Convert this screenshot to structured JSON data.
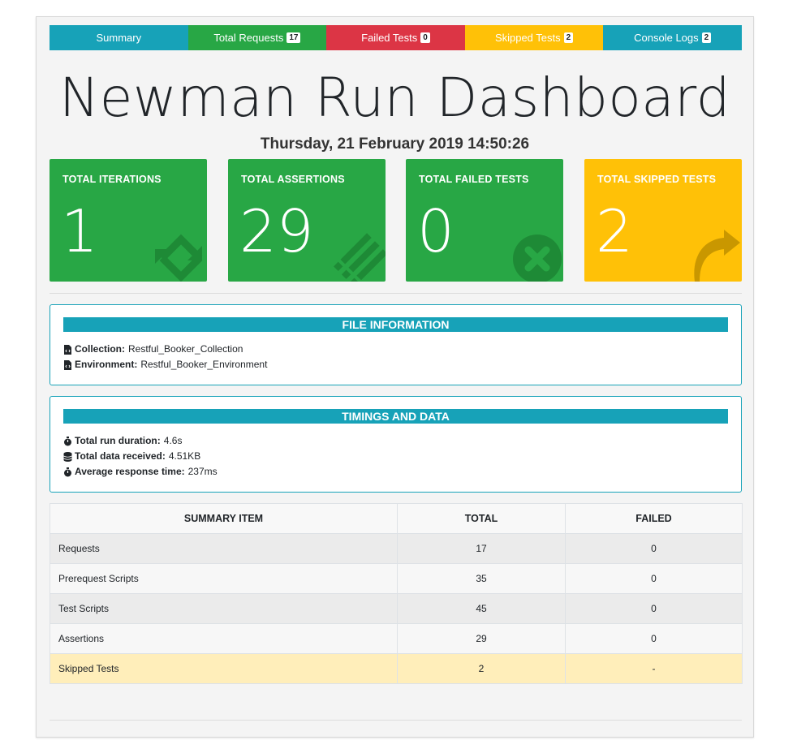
{
  "tabs": [
    {
      "label": "Summary",
      "badge": ""
    },
    {
      "label": "Total Requests",
      "badge": "17"
    },
    {
      "label": "Failed Tests",
      "badge": "0"
    },
    {
      "label": "Skipped Tests",
      "badge": "2"
    },
    {
      "label": "Console Logs",
      "badge": "2"
    }
  ],
  "title": "Newman Run Dashboard",
  "datetime": "Thursday, 21 February 2019 14:50:26",
  "cards": [
    {
      "label": "TOTAL ITERATIONS",
      "value": "1",
      "icon": "sync-icon",
      "color": "#28a745"
    },
    {
      "label": "TOTAL ASSERTIONS",
      "value": "29",
      "icon": "list-icon",
      "color": "#28a745"
    },
    {
      "label": "TOTAL FAILED TESTS",
      "value": "0",
      "icon": "times-circle-icon",
      "color": "#28a745"
    },
    {
      "label": "TOTAL SKIPPED TESTS",
      "value": "2",
      "icon": "share-arrow-icon",
      "color": "#ffc107"
    }
  ],
  "file_info": {
    "heading": "FILE INFORMATION",
    "collection_key": "Collection:",
    "collection_value": "Restful_Booker_Collection",
    "environment_key": "Environment:",
    "environment_value": "Restful_Booker_Environment"
  },
  "timings": {
    "heading": "TIMINGS AND DATA",
    "duration_key": "Total run duration:",
    "duration_value": "4.6s",
    "data_key": "Total data received:",
    "data_value": "4.51KB",
    "avg_key": "Average response time:",
    "avg_value": "237ms"
  },
  "summary_table": {
    "headers": [
      "SUMMARY ITEM",
      "TOTAL",
      "FAILED"
    ],
    "rows": [
      {
        "item": "Requests",
        "total": "17",
        "failed": "0"
      },
      {
        "item": "Prerequest Scripts",
        "total": "35",
        "failed": "0"
      },
      {
        "item": "Test Scripts",
        "total": "45",
        "failed": "0"
      },
      {
        "item": "Assertions",
        "total": "29",
        "failed": "0"
      },
      {
        "item": "Skipped Tests",
        "total": "2",
        "failed": "-"
      }
    ]
  },
  "colors": {
    "info": "#17a2b8",
    "success": "#28a745",
    "danger": "#dc3545",
    "warning": "#ffc107"
  }
}
